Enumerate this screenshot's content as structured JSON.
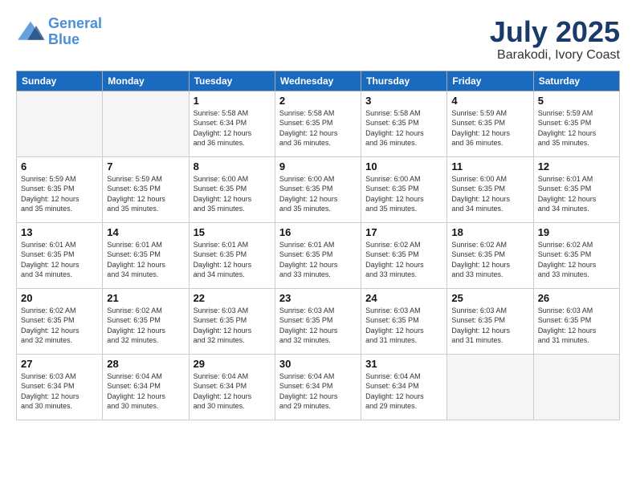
{
  "logo": {
    "text_general": "General",
    "text_blue": "Blue"
  },
  "title": "July 2025",
  "location": "Barakodi, Ivory Coast",
  "days_of_week": [
    "Sunday",
    "Monday",
    "Tuesday",
    "Wednesday",
    "Thursday",
    "Friday",
    "Saturday"
  ],
  "weeks": [
    [
      {
        "day": "",
        "info": ""
      },
      {
        "day": "",
        "info": ""
      },
      {
        "day": "1",
        "info": "Sunrise: 5:58 AM\nSunset: 6:34 PM\nDaylight: 12 hours\nand 36 minutes."
      },
      {
        "day": "2",
        "info": "Sunrise: 5:58 AM\nSunset: 6:35 PM\nDaylight: 12 hours\nand 36 minutes."
      },
      {
        "day": "3",
        "info": "Sunrise: 5:58 AM\nSunset: 6:35 PM\nDaylight: 12 hours\nand 36 minutes."
      },
      {
        "day": "4",
        "info": "Sunrise: 5:59 AM\nSunset: 6:35 PM\nDaylight: 12 hours\nand 36 minutes."
      },
      {
        "day": "5",
        "info": "Sunrise: 5:59 AM\nSunset: 6:35 PM\nDaylight: 12 hours\nand 35 minutes."
      }
    ],
    [
      {
        "day": "6",
        "info": "Sunrise: 5:59 AM\nSunset: 6:35 PM\nDaylight: 12 hours\nand 35 minutes."
      },
      {
        "day": "7",
        "info": "Sunrise: 5:59 AM\nSunset: 6:35 PM\nDaylight: 12 hours\nand 35 minutes."
      },
      {
        "day": "8",
        "info": "Sunrise: 6:00 AM\nSunset: 6:35 PM\nDaylight: 12 hours\nand 35 minutes."
      },
      {
        "day": "9",
        "info": "Sunrise: 6:00 AM\nSunset: 6:35 PM\nDaylight: 12 hours\nand 35 minutes."
      },
      {
        "day": "10",
        "info": "Sunrise: 6:00 AM\nSunset: 6:35 PM\nDaylight: 12 hours\nand 35 minutes."
      },
      {
        "day": "11",
        "info": "Sunrise: 6:00 AM\nSunset: 6:35 PM\nDaylight: 12 hours\nand 34 minutes."
      },
      {
        "day": "12",
        "info": "Sunrise: 6:01 AM\nSunset: 6:35 PM\nDaylight: 12 hours\nand 34 minutes."
      }
    ],
    [
      {
        "day": "13",
        "info": "Sunrise: 6:01 AM\nSunset: 6:35 PM\nDaylight: 12 hours\nand 34 minutes."
      },
      {
        "day": "14",
        "info": "Sunrise: 6:01 AM\nSunset: 6:35 PM\nDaylight: 12 hours\nand 34 minutes."
      },
      {
        "day": "15",
        "info": "Sunrise: 6:01 AM\nSunset: 6:35 PM\nDaylight: 12 hours\nand 34 minutes."
      },
      {
        "day": "16",
        "info": "Sunrise: 6:01 AM\nSunset: 6:35 PM\nDaylight: 12 hours\nand 33 minutes."
      },
      {
        "day": "17",
        "info": "Sunrise: 6:02 AM\nSunset: 6:35 PM\nDaylight: 12 hours\nand 33 minutes."
      },
      {
        "day": "18",
        "info": "Sunrise: 6:02 AM\nSunset: 6:35 PM\nDaylight: 12 hours\nand 33 minutes."
      },
      {
        "day": "19",
        "info": "Sunrise: 6:02 AM\nSunset: 6:35 PM\nDaylight: 12 hours\nand 33 minutes."
      }
    ],
    [
      {
        "day": "20",
        "info": "Sunrise: 6:02 AM\nSunset: 6:35 PM\nDaylight: 12 hours\nand 32 minutes."
      },
      {
        "day": "21",
        "info": "Sunrise: 6:02 AM\nSunset: 6:35 PM\nDaylight: 12 hours\nand 32 minutes."
      },
      {
        "day": "22",
        "info": "Sunrise: 6:03 AM\nSunset: 6:35 PM\nDaylight: 12 hours\nand 32 minutes."
      },
      {
        "day": "23",
        "info": "Sunrise: 6:03 AM\nSunset: 6:35 PM\nDaylight: 12 hours\nand 32 minutes."
      },
      {
        "day": "24",
        "info": "Sunrise: 6:03 AM\nSunset: 6:35 PM\nDaylight: 12 hours\nand 31 minutes."
      },
      {
        "day": "25",
        "info": "Sunrise: 6:03 AM\nSunset: 6:35 PM\nDaylight: 12 hours\nand 31 minutes."
      },
      {
        "day": "26",
        "info": "Sunrise: 6:03 AM\nSunset: 6:35 PM\nDaylight: 12 hours\nand 31 minutes."
      }
    ],
    [
      {
        "day": "27",
        "info": "Sunrise: 6:03 AM\nSunset: 6:34 PM\nDaylight: 12 hours\nand 30 minutes."
      },
      {
        "day": "28",
        "info": "Sunrise: 6:04 AM\nSunset: 6:34 PM\nDaylight: 12 hours\nand 30 minutes."
      },
      {
        "day": "29",
        "info": "Sunrise: 6:04 AM\nSunset: 6:34 PM\nDaylight: 12 hours\nand 30 minutes."
      },
      {
        "day": "30",
        "info": "Sunrise: 6:04 AM\nSunset: 6:34 PM\nDaylight: 12 hours\nand 29 minutes."
      },
      {
        "day": "31",
        "info": "Sunrise: 6:04 AM\nSunset: 6:34 PM\nDaylight: 12 hours\nand 29 minutes."
      },
      {
        "day": "",
        "info": ""
      },
      {
        "day": "",
        "info": ""
      }
    ]
  ]
}
